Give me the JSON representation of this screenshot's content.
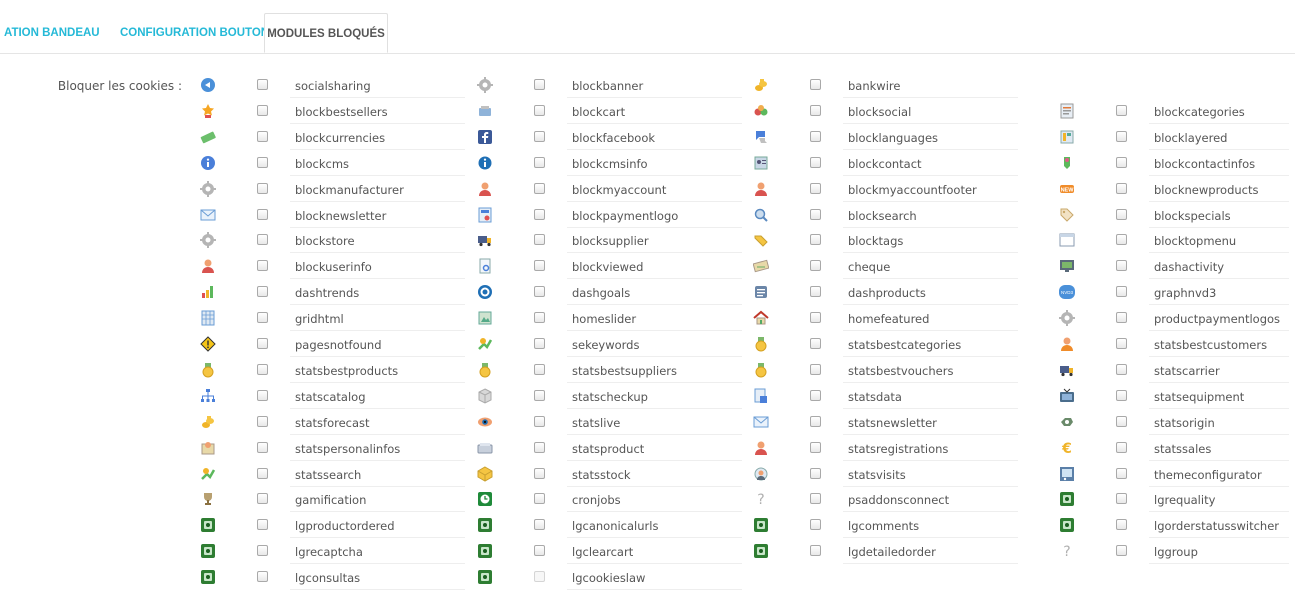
{
  "tabs": [
    {
      "label": "ATION BANDEAU"
    },
    {
      "label": "CONFIGURATION BOUTONS"
    },
    {
      "label": "MODULES BLOQUÉS"
    }
  ],
  "field_label": "Bloquer les cookies :",
  "colors": {
    "accent": "#25b9d7",
    "text": "#555555",
    "divider": "#eeeeee"
  },
  "rows": [
    [
      {
        "name": "socialsharing",
        "icon": "share-icon"
      },
      {
        "name": "blockbanner",
        "icon": "gear-icon"
      },
      {
        "name": "bankwire",
        "icon": "coins-icon"
      },
      null
    ],
    [
      {
        "name": "blockbestsellers",
        "icon": "star-badge-icon"
      },
      {
        "name": "blockcart",
        "icon": "cart-icon"
      },
      {
        "name": "blocksocial",
        "icon": "social-icon"
      },
      {
        "name": "blockcategories",
        "icon": "categories-icon"
      }
    ],
    [
      {
        "name": "blockcurrencies",
        "icon": "money-icon"
      },
      {
        "name": "blockfacebook",
        "icon": "facebook-icon"
      },
      {
        "name": "blocklanguages",
        "icon": "languages-icon"
      },
      {
        "name": "blocklayered",
        "icon": "layered-icon"
      }
    ],
    [
      {
        "name": "blockcms",
        "icon": "info-circle-icon"
      },
      {
        "name": "blockcmsinfo",
        "icon": "info-icon"
      },
      {
        "name": "blockcontact",
        "icon": "contact-icon"
      },
      {
        "name": "blockcontactinfos",
        "icon": "contactinfo-icon"
      }
    ],
    [
      {
        "name": "blockmanufacturer",
        "icon": "gear-icon"
      },
      {
        "name": "blockmyaccount",
        "icon": "user-icon"
      },
      {
        "name": "blockmyaccountfooter",
        "icon": "user-icon"
      },
      {
        "name": "blocknewproducts",
        "icon": "new-badge-icon"
      }
    ],
    [
      {
        "name": "blocknewsletter",
        "icon": "envelope-icon"
      },
      {
        "name": "blockpaymentlogo",
        "icon": "payment-icon"
      },
      {
        "name": "blocksearch",
        "icon": "search-icon"
      },
      {
        "name": "blockspecials",
        "icon": "tag-icon"
      }
    ],
    [
      {
        "name": "blockstore",
        "icon": "gear-icon"
      },
      {
        "name": "blocksupplier",
        "icon": "truck-icon"
      },
      {
        "name": "blocktags",
        "icon": "tags-icon"
      },
      {
        "name": "blocktopmenu",
        "icon": "window-icon"
      }
    ],
    [
      {
        "name": "blockuserinfo",
        "icon": "user-icon"
      },
      {
        "name": "blockviewed",
        "icon": "document-view-icon"
      },
      {
        "name": "cheque",
        "icon": "cheque-icon"
      },
      {
        "name": "dashactivity",
        "icon": "monitor-icon"
      }
    ],
    [
      {
        "name": "dashtrends",
        "icon": "bar-chart-icon"
      },
      {
        "name": "dashgoals",
        "icon": "target-icon"
      },
      {
        "name": "dashproducts",
        "icon": "list-icon"
      },
      {
        "name": "graphnvd3",
        "icon": "nvd3-icon"
      }
    ],
    [
      {
        "name": "gridhtml",
        "icon": "grid-icon"
      },
      {
        "name": "homeslider",
        "icon": "slider-icon"
      },
      {
        "name": "homefeatured",
        "icon": "home-icon"
      },
      {
        "name": "productpaymentlogos",
        "icon": "gear-icon"
      }
    ],
    [
      {
        "name": "pagesnotfound",
        "icon": "warning-icon"
      },
      {
        "name": "sekeywords",
        "icon": "keywords-icon"
      },
      {
        "name": "statsbestcategories",
        "icon": "medal-icon"
      },
      {
        "name": "statsbestcustomers",
        "icon": "user-orange-icon"
      }
    ],
    [
      {
        "name": "statsbestproducts",
        "icon": "medal-icon"
      },
      {
        "name": "statsbestsuppliers",
        "icon": "medal-icon"
      },
      {
        "name": "statsbestvouchers",
        "icon": "medal-icon"
      },
      {
        "name": "statscarrier",
        "icon": "truck-icon"
      }
    ],
    [
      {
        "name": "statscatalog",
        "icon": "sitemap-icon"
      },
      {
        "name": "statscheckup",
        "icon": "box-icon"
      },
      {
        "name": "statsdata",
        "icon": "data-icon"
      },
      {
        "name": "statsequipment",
        "icon": "tv-icon"
      }
    ],
    [
      {
        "name": "statsforecast",
        "icon": "coins-icon"
      },
      {
        "name": "statslive",
        "icon": "eye-icon"
      },
      {
        "name": "statsnewsletter",
        "icon": "envelope-icon"
      },
      {
        "name": "statsorigin",
        "icon": "origin-icon"
      }
    ],
    [
      {
        "name": "statspersonalinfos",
        "icon": "personal-info-icon"
      },
      {
        "name": "statsproduct",
        "icon": "product-icon"
      },
      {
        "name": "statsregistrations",
        "icon": "user-icon"
      },
      {
        "name": "statssales",
        "icon": "euro-icon"
      }
    ],
    [
      {
        "name": "statssearch",
        "icon": "keywords-icon"
      },
      {
        "name": "statsstock",
        "icon": "stock-icon"
      },
      {
        "name": "statsvisits",
        "icon": "visits-icon"
      },
      {
        "name": "themeconfigurator",
        "icon": "theme-icon"
      }
    ],
    [
      {
        "name": "gamification",
        "icon": "trophy-icon"
      },
      {
        "name": "cronjobs",
        "icon": "clock-icon"
      },
      {
        "name": "psaddonsconnect",
        "icon": "question-icon"
      },
      {
        "name": "lgrequality",
        "icon": "lg-icon"
      }
    ],
    [
      {
        "name": "lgproductordered",
        "icon": "lg-icon"
      },
      {
        "name": "lgcanonicalurls",
        "icon": "lg-icon"
      },
      {
        "name": "lgcomments",
        "icon": "lg-icon"
      },
      {
        "name": "lgorderstatusswitcher",
        "icon": "lg-icon"
      }
    ],
    [
      {
        "name": "lgrecaptcha",
        "icon": "lg-icon"
      },
      {
        "name": "lgclearcart",
        "icon": "lg-icon"
      },
      {
        "name": "lgdetailedorder",
        "icon": "lg-icon"
      },
      {
        "name": "lggroup",
        "icon": "question-icon"
      }
    ],
    [
      {
        "name": "lgconsultas",
        "icon": "lg-icon"
      },
      {
        "name": "lgcookieslaw",
        "icon": "lg-icon",
        "disabled": true
      },
      null,
      null
    ]
  ]
}
